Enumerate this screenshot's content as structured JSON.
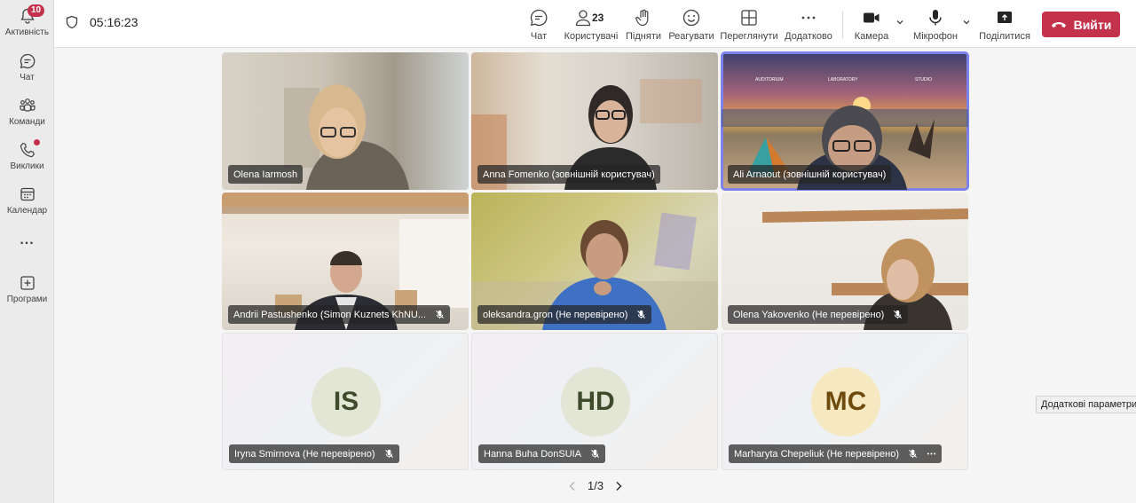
{
  "rail": {
    "activity": {
      "label": "Активність",
      "badge": "10"
    },
    "chat": {
      "label": "Чат"
    },
    "teams": {
      "label": "Команди"
    },
    "calls": {
      "label": "Виклики"
    },
    "calendar": {
      "label": "Календар"
    },
    "more": {
      "label": "..."
    },
    "apps": {
      "label": "Програми"
    }
  },
  "topbar": {
    "timer": "05:16:23",
    "chat_label": "Чат",
    "people_label": "Користувачі",
    "people_count": "23",
    "raise_label": "Підняти",
    "react_label": "Реагувати",
    "view_label": "Переглянути",
    "more_label": "Додатково",
    "camera_label": "Камера",
    "mic_label": "Мікрофон",
    "share_label": "Поділитися",
    "leave_label": "Вийти"
  },
  "participants": [
    {
      "name": "Olena Iarmosh",
      "muted": false,
      "type": "video"
    },
    {
      "name": "Anna Fomenko (зовнішній користувач)",
      "muted": false,
      "type": "video"
    },
    {
      "name": "Ali Arnaout (зовнішній користувач)",
      "muted": false,
      "type": "video",
      "speaking": true
    },
    {
      "name": "Andrii Pastushenko (Simon Kuznets KhNU...",
      "muted": true,
      "type": "video"
    },
    {
      "name": "oleksandra.gron (Не перевірено)",
      "muted": true,
      "type": "video"
    },
    {
      "name": "Olena Yakovenko (Не перевірено)",
      "muted": true,
      "type": "video"
    },
    {
      "name": "Iryna Smirnova (Не перевірено)",
      "muted": true,
      "type": "avatar",
      "initials": "IS"
    },
    {
      "name": "Hanna Buha DonSUIA",
      "muted": true,
      "type": "avatar",
      "initials": "HD"
    },
    {
      "name": "Marharyta Chepeliuk (Не перевірено)",
      "muted": true,
      "type": "avatar",
      "initials": "MC"
    }
  ],
  "slide_labels": {
    "a": "AUDITORIUM",
    "b": "LABORATORY",
    "c": "STUDIO"
  },
  "pager": {
    "text": "1/3"
  },
  "tooltip": "Додаткові параметри",
  "colors": {
    "leave": "#c4314b",
    "badge": "#c4314b",
    "speaking": "#7b83eb"
  }
}
